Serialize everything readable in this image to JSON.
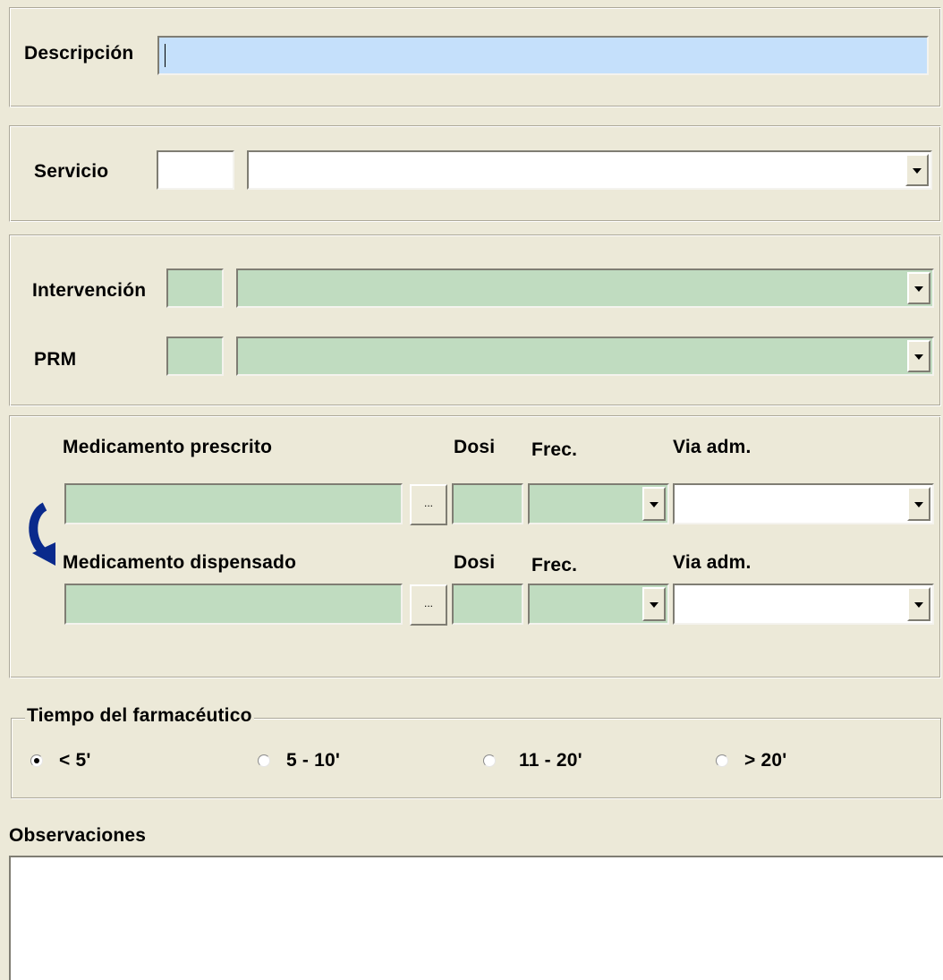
{
  "descripcion": {
    "label": "Descripción",
    "value": ""
  },
  "servicio": {
    "label": "Servicio",
    "code": "",
    "value": ""
  },
  "intervencion": {
    "label": "Intervención",
    "code": "",
    "value": ""
  },
  "prm": {
    "label": "PRM",
    "code": "",
    "value": ""
  },
  "medicamentos": {
    "prescrito": {
      "label": "Medicamento prescrito",
      "dosi": "Dosi",
      "frec": "Frec.",
      "via": "Via adm.",
      "browse": "..."
    },
    "dispensado": {
      "label": "Medicamento dispensado",
      "dosi": "Dosi",
      "frec": "Frec.",
      "via": "Via adm.",
      "browse": "..."
    },
    "swap_icon": "curved-arrow-icon"
  },
  "tiempo": {
    "title": "Tiempo del farmacéutico",
    "options": [
      "< 5'",
      "5 - 10'",
      "11 - 20'",
      "> 20'"
    ],
    "selected": "< 5'"
  },
  "observaciones": {
    "label": "Observaciones",
    "value": ""
  },
  "colors": {
    "window": "#ece9d8",
    "green_field": "#c0dcc0",
    "focus_field": "#c5e0fb",
    "icon": "#0a2a8c"
  }
}
